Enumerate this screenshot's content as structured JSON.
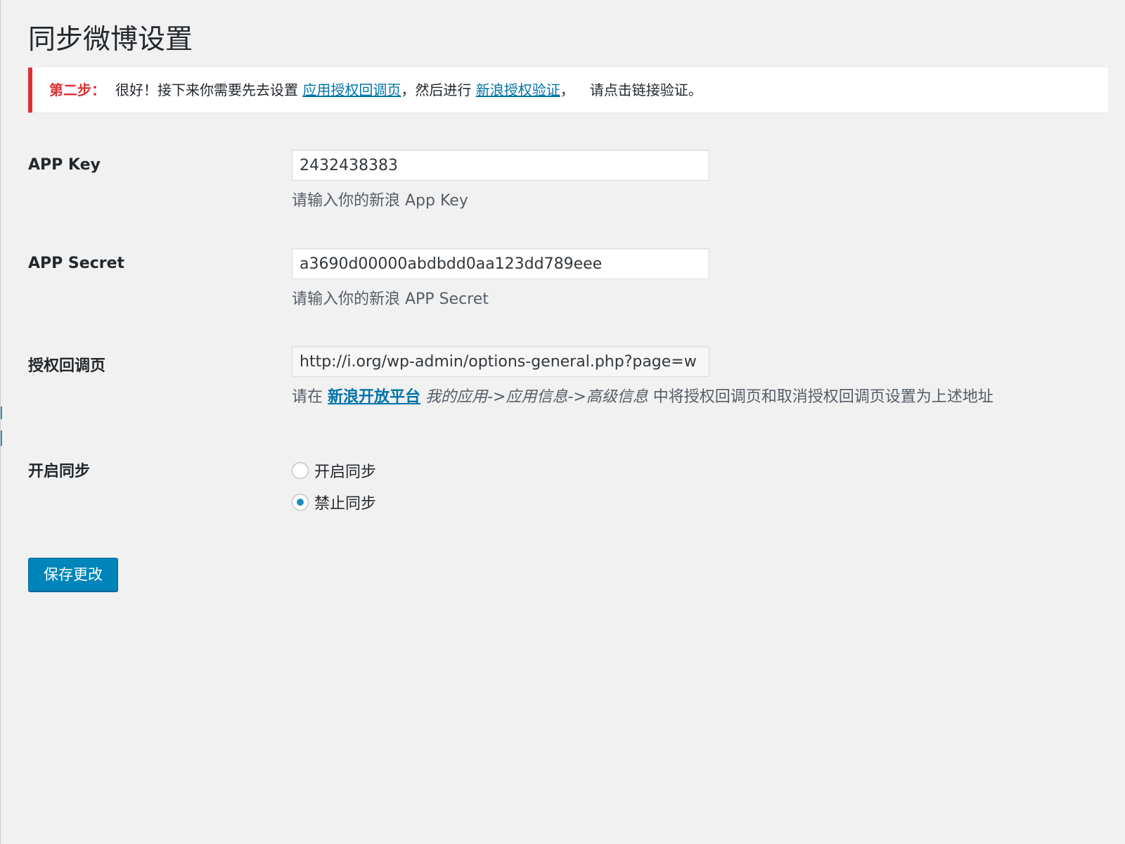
{
  "page": {
    "title": "同步微博设置"
  },
  "notice": {
    "step_label": "第二步：",
    "text_before": "很好！接下来你需要先去设置 ",
    "link_callback": "应用授权回调页",
    "text_middle": "，然后进行 ",
    "link_auth": "新浪授权验证",
    "text_after": "，",
    "text_end": "请点击链接验证。"
  },
  "fields": {
    "app_key": {
      "label": "APP Key",
      "value": "2432438383",
      "description": "请输入你的新浪 App Key"
    },
    "app_secret": {
      "label": "APP Secret",
      "value": "a3690d00000abdbdd0aa123dd789eee",
      "description": "请输入你的新浪 APP Secret"
    },
    "callback": {
      "label": "授权回调页",
      "value": "http://i.org/wp-admin/options-general.php?page=w",
      "desc_prefix": "请在 ",
      "desc_link": "新浪开放平台",
      "desc_path": "我的应用->应用信息->高级信息",
      "desc_suffix": " 中将授权回调页和取消授权回调页设置为上述地址"
    },
    "sync": {
      "label": "开启同步",
      "options": [
        {
          "label": "开启同步",
          "checked": false
        },
        {
          "label": "禁止同步",
          "checked": true
        }
      ]
    }
  },
  "actions": {
    "save_label": "保存更改"
  },
  "colors": {
    "notice_border": "#dc3232",
    "link": "#0073aa",
    "primary_button": "#0085ba",
    "radio_dot": "#1e8cbe"
  }
}
